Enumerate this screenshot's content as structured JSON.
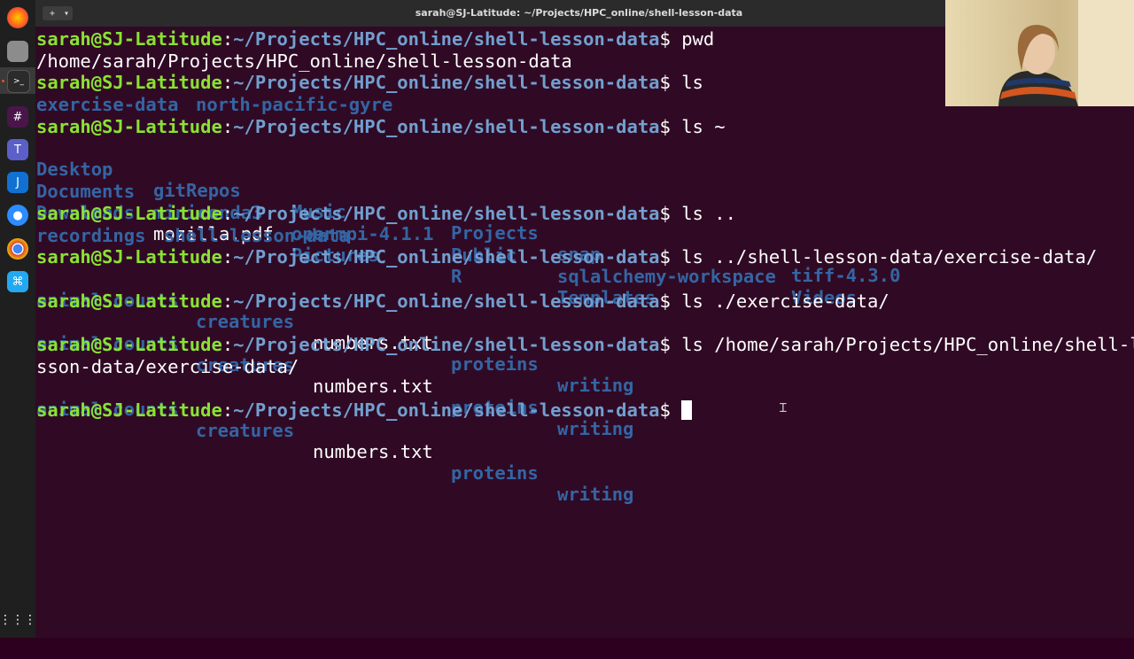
{
  "window": {
    "title": "sarah@SJ-Latitude: ~/Projects/HPC_online/shell-lesson-data"
  },
  "dock": {
    "icons": [
      "firefox-icon",
      "files-icon",
      "terminal-icon",
      "slack-icon",
      "teams-icon",
      "joplin-icon",
      "zoom-icon",
      "chrome-icon",
      "vscode-icon"
    ],
    "grid_label": "⋮⋮⋮"
  },
  "prompt": {
    "user": "sarah@SJ-Latitude",
    "path": "~/Projects/HPC_online/shell-lesson-data"
  },
  "lines": {
    "l1_cmd": "$ pwd",
    "l2_out": "/home/sarah/Projects/HPC_online/shell-lesson-data",
    "l3_cmd": "$ ls",
    "l4_out": [
      "exercise-data",
      "north-pacific-gyre"
    ],
    "l5_cmd": "$ ls ~",
    "home_row1": [
      "Desktop",
      "gitRepos",
      "Music",
      "Projects",
      "snap",
      "tiff-4.3.0"
    ],
    "home_row2": [
      "Documents",
      "miniconda3",
      "openmpi-4.1.1",
      "Public",
      "sqlalchemy-workspace",
      "Videos"
    ],
    "home_row3": [
      "Downloads",
      "mozilla.pdf",
      "Pictures",
      "R",
      "Templates"
    ],
    "l9_cmd": "$ ls ..",
    "l10_out": [
      "recordings",
      "shell-lesson-data"
    ],
    "l11_cmd": "$ ls ../shell-lesson-data/exercise-data/",
    "ex_out": [
      "animal-counts",
      "creatures",
      "numbers.txt",
      "proteins",
      "writing"
    ],
    "l13_cmd": "$ ls ./exercise-data/",
    "l15_cmd": "$ ls /home/sarah/Projects/HPC_online/shell-le",
    "l16_wrap": "sson-data/exercise-data/",
    "l18_cmd": "$ "
  },
  "colors": {
    "background": "#300a24",
    "user": "#8ae234",
    "path": "#729fcf",
    "directory": "#3465a4",
    "text": "#ffffff"
  }
}
